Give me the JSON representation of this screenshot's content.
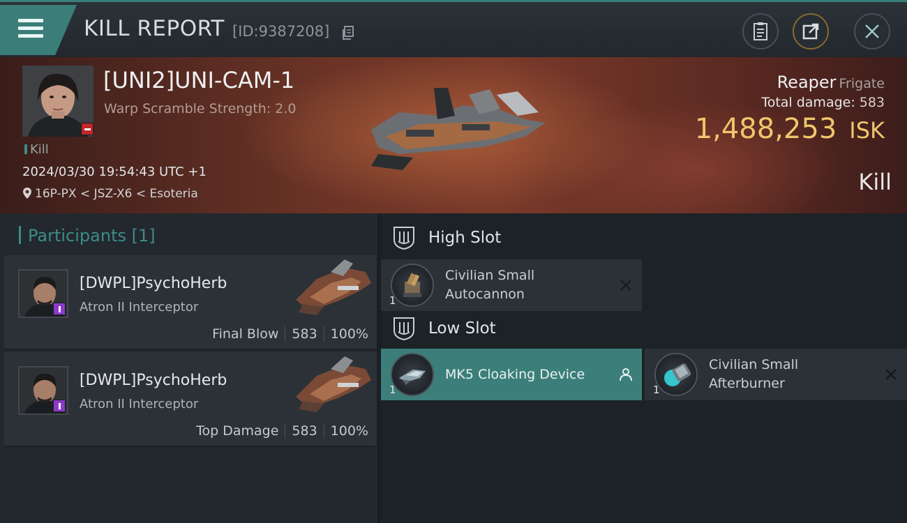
{
  "header": {
    "title": "KILL REPORT",
    "report_id": "[ID:9387208]"
  },
  "victim": {
    "name": "[UNI2]UNI-CAM-1",
    "warp_scramble": "Warp Scramble Strength: 2.0",
    "kill_tag": "Kill",
    "datetime": "2024/03/30 19:54:43 UTC +1",
    "location": "16P-PX < JSZ-X6 < Esoteria",
    "ship_name": "Reaper",
    "ship_class": "Frigate",
    "total_damage_label": "Total damage:",
    "total_damage": "583",
    "isk_value": "1,488,253",
    "isk_unit": "ISK",
    "result": "Kill"
  },
  "participants": {
    "label": "Participants",
    "count": "[1]",
    "rows": [
      {
        "name": "[DWPL]PsychoHerb",
        "ship": "Atron II Interceptor",
        "role": "Final Blow",
        "damage": "583",
        "percent": "100%"
      },
      {
        "name": "[DWPL]PsychoHerb",
        "ship": "Atron II Interceptor",
        "role": "Top Damage",
        "damage": "583",
        "percent": "100%"
      }
    ]
  },
  "fittings": {
    "high_slot": {
      "label": "High Slot",
      "modules": [
        {
          "qty": "1",
          "name_line1": "Civilian Small",
          "name_line2": "Autocannon"
        }
      ]
    },
    "low_slot": {
      "label": "Low Slot",
      "modules": [
        {
          "qty": "1",
          "name_line1": "MK5 Cloaking Device",
          "name_line2": ""
        },
        {
          "qty": "1",
          "name_line1": "Civilian Small",
          "name_line2": "Afterburner"
        }
      ]
    }
  },
  "colors": {
    "accent_teal": "#3d8c8a",
    "isk_gold": "#f0c66c",
    "highlight_module": "#3c7e7a"
  }
}
